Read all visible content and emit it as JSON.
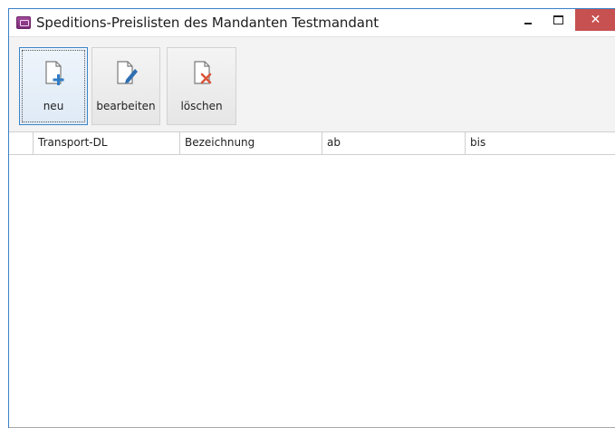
{
  "window": {
    "title": "Speditions-Preislisten des Mandanten Testmandant",
    "app_icon": "truck-window-icon",
    "controls": {
      "minimize": "minimize-icon",
      "maximize": "maximize-icon",
      "close": "close-icon",
      "close_color": "#c75050"
    }
  },
  "toolbar": {
    "buttons": [
      {
        "label": "neu",
        "icon": "document-add-icon",
        "focused": true
      },
      {
        "label": "bearbeiten",
        "icon": "document-edit-icon",
        "focused": false
      },
      {
        "label": "löschen",
        "icon": "document-delete-icon",
        "focused": false
      }
    ]
  },
  "grid": {
    "columns": [
      "Transport-DL",
      "Bezeichnung",
      "ab",
      "bis"
    ],
    "rows": []
  },
  "colors": {
    "accent": "#3b86c9",
    "add_icon": "#2f7cc5",
    "edit_icon": "#2f6fb2",
    "delete_icon": "#d9553b"
  }
}
